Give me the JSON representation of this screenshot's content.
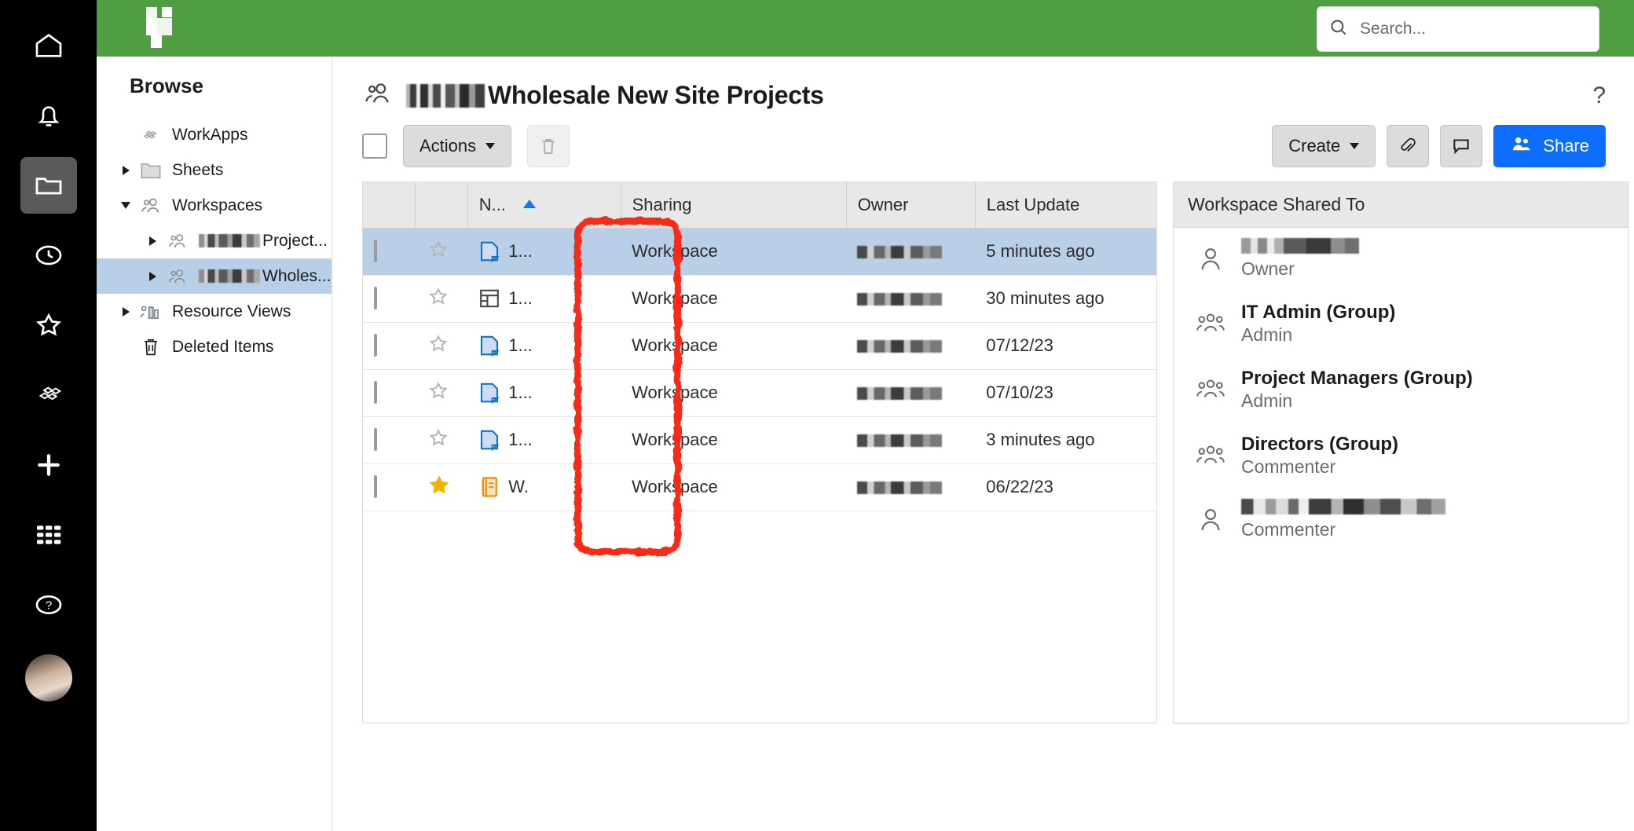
{
  "rail": {
    "items": [
      {
        "name": "home-icon",
        "label": "Home",
        "active": false
      },
      {
        "name": "notifications-bell-icon",
        "label": "Notifications",
        "active": false
      },
      {
        "name": "browse-folder-icon",
        "label": "Browse",
        "active": true
      },
      {
        "name": "recents-clock-icon",
        "label": "Recents",
        "active": false
      },
      {
        "name": "favorites-star-icon",
        "label": "Favorites",
        "active": false
      },
      {
        "name": "workapps-icon",
        "label": "WorkApps",
        "active": false
      },
      {
        "name": "create-plus-icon",
        "label": "Create",
        "active": false
      },
      {
        "name": "apps-grid-icon",
        "label": "Solution Center",
        "active": false
      },
      {
        "name": "help-circle-icon",
        "label": "Help",
        "active": false
      }
    ]
  },
  "topbar": {
    "brand": "smartsheet-logo",
    "brand_color": "#4F9E41",
    "search": {
      "placeholder": "Search...",
      "value": ""
    }
  },
  "browse": {
    "title": "Browse",
    "items": [
      {
        "label": "WorkApps",
        "icon": "workapps-icon",
        "caret": "none",
        "level": 1,
        "selected": false,
        "redacted": false
      },
      {
        "label": "Sheets",
        "icon": "folder-icon",
        "caret": "right",
        "level": 1,
        "selected": false,
        "redacted": false
      },
      {
        "label": "Workspaces",
        "icon": "workspace-people-icon",
        "caret": "down",
        "level": 1,
        "selected": false,
        "redacted": false
      },
      {
        "label": "Project...",
        "icon": "workspace-people-icon",
        "caret": "right",
        "level": 2,
        "selected": false,
        "redacted": true
      },
      {
        "label": "Wholes...",
        "icon": "workspace-people-icon",
        "caret": "right",
        "level": 2,
        "selected": true,
        "redacted": true
      },
      {
        "label": "Resource Views",
        "icon": "resource-views-icon",
        "caret": "right",
        "level": 1,
        "selected": false,
        "redacted": false
      },
      {
        "label": "Deleted Items",
        "icon": "trash-icon",
        "caret": "none",
        "level": 1,
        "selected": false,
        "redacted": false
      }
    ]
  },
  "page": {
    "title": "Wholesale New Site Projects",
    "title_redacted_prefix": true,
    "help_label": "?"
  },
  "toolbar": {
    "select_all_checked": false,
    "actions_label": "Actions",
    "delete_label": "delete",
    "create_label": "Create",
    "attach_label": "attachments",
    "comment_label": "comments",
    "share_label": "Share",
    "share_color": "#0d6efd"
  },
  "table": {
    "columns": [
      "N...",
      "Sharing",
      "Owner",
      "Last Update"
    ],
    "sort_column": "N...",
    "sort_direction": "asc",
    "sort_arrow_color": "#1a73e8",
    "rows": [
      {
        "name": "1...",
        "icon": "sheet-icon",
        "sharing": "Workspace",
        "owner": "",
        "last_update": "5 minutes ago",
        "starred": false,
        "selected": true,
        "checked": false
      },
      {
        "name": "1...",
        "icon": "report-icon",
        "sharing": "Workspace",
        "owner": "",
        "last_update": "30 minutes ago",
        "starred": false,
        "selected": false,
        "checked": false
      },
      {
        "name": "1...",
        "icon": "sheet-icon",
        "sharing": "Workspace",
        "owner": "",
        "last_update": "07/12/23",
        "starred": false,
        "selected": false,
        "checked": false
      },
      {
        "name": "1...",
        "icon": "sheet-icon",
        "sharing": "Workspace",
        "owner": "",
        "last_update": "07/10/23",
        "starred": false,
        "selected": false,
        "checked": false
      },
      {
        "name": "1...",
        "icon": "sheet-icon",
        "sharing": "Workspace",
        "owner": "",
        "last_update": "3 minutes ago",
        "starred": false,
        "selected": false,
        "checked": false
      },
      {
        "name": "W.",
        "icon": "workapp-notebook-icon",
        "sharing": "Workspace",
        "owner": "",
        "last_update": "06/22/23",
        "starred": true,
        "selected": false,
        "checked": false
      }
    ]
  },
  "shared_panel": {
    "title": "Workspace Shared To",
    "entries": [
      {
        "name": "",
        "redacted": true,
        "redact_width": "narrow",
        "role": "Owner",
        "icon": "person-icon"
      },
      {
        "name": "IT Admin (Group)",
        "redacted": false,
        "role": "Admin",
        "icon": "group-icon"
      },
      {
        "name": "Project Managers (Group)",
        "redacted": false,
        "role": "Admin",
        "icon": "group-icon"
      },
      {
        "name": "Directors (Group)",
        "redacted": false,
        "role": "Commenter",
        "icon": "group-icon"
      },
      {
        "name": "",
        "redacted": true,
        "redact_width": "wide",
        "role": "Commenter",
        "icon": "person-icon"
      }
    ]
  },
  "annotation": {
    "type": "rectangle-highlight",
    "color": "#fb2b13",
    "target": "name-column"
  }
}
